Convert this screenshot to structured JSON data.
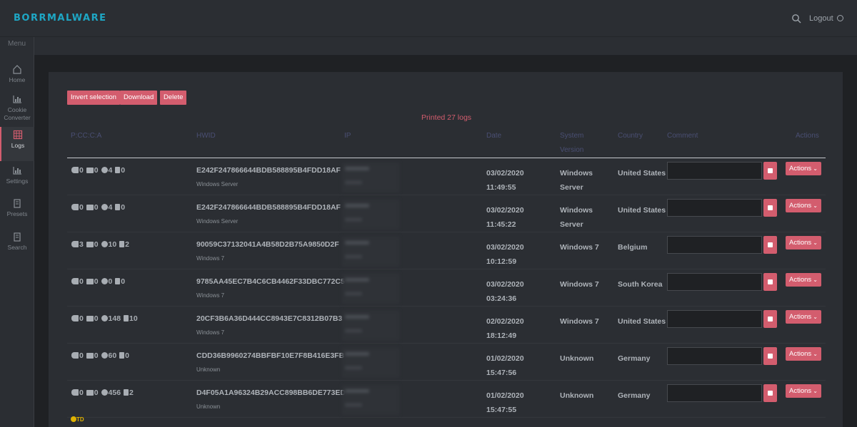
{
  "app": {
    "brand": "BORRMALWARE",
    "logout_label": "Logout"
  },
  "sidebar": {
    "menu_label": "Menu",
    "items": [
      {
        "label": "Home",
        "icon": "home-icon"
      },
      {
        "label": "Cookie Converter",
        "icon": "chart-icon"
      },
      {
        "label": "Logs",
        "icon": "grid-icon",
        "active": true
      },
      {
        "label": "Settings",
        "icon": "chart-icon"
      },
      {
        "label": "Presets",
        "icon": "clipboard-icon"
      },
      {
        "label": "Search",
        "icon": "clipboard-icon"
      }
    ]
  },
  "toolbar": {
    "invert_label": "Invert selection",
    "download_label": "Download",
    "delete_label": "Delete"
  },
  "status": "Printed 27 logs",
  "table": {
    "columns": {
      "pccca": "P:CC:C:A",
      "hwid": "HWID",
      "ip": "IP",
      "date": "Date",
      "system": "System Version",
      "country": "Country",
      "comment": "Comment",
      "actions": "Actions"
    },
    "action_button_label": "Actions",
    "rows": [
      {
        "p": "0",
        "cc": "0",
        "c": "4",
        "a": "0",
        "hwid": "E242F247866644BDB588895B4FDD18AF",
        "os": "Windows Server",
        "date": "03/02/2020",
        "time": "11:49:55",
        "system": "Windows Server",
        "country": "United States"
      },
      {
        "p": "0",
        "cc": "0",
        "c": "4",
        "a": "0",
        "hwid": "E242F247866644BDB588895B4FDD18AF",
        "os": "Windows Server",
        "date": "03/02/2020",
        "time": "11:45:22",
        "system": "Windows Server",
        "country": "United States"
      },
      {
        "p": "3",
        "cc": "0",
        "c": "10",
        "a": "2",
        "hwid": "90059C37132041A4B58D2B75A9850D2F",
        "os": "Windows 7",
        "date": "03/02/2020",
        "time": "10:12:59",
        "system": "Windows 7",
        "country": "Belgium"
      },
      {
        "p": "0",
        "cc": "0",
        "c": "0",
        "a": "0",
        "hwid": "9785AA45EC7B4C6CB4462F33DBC772C5",
        "os": "Windows 7",
        "date": "03/02/2020",
        "time": "03:24:36",
        "system": "Windows 7",
        "country": "South Korea"
      },
      {
        "p": "0",
        "cc": "0",
        "c": "148",
        "a": "10",
        "hwid": "20CF3B6A36D444CC8943E7C8312B07B3",
        "os": "Windows 7",
        "date": "02/02/2020",
        "time": "18:12:49",
        "system": "Windows 7",
        "country": "United States"
      },
      {
        "p": "0",
        "cc": "0",
        "c": "60",
        "a": "0",
        "hwid": "CDD36B9960274BBFBF10E7F8B416E3FB",
        "os": "Unknown",
        "date": "01/02/2020",
        "time": "15:47:56",
        "system": "Unknown",
        "country": "Germany"
      },
      {
        "p": "0",
        "cc": "0",
        "c": "456",
        "a": "2",
        "hwid": "D4F05A1A96324B29ACC898BB6DE773ED",
        "os": "Unknown",
        "date": "01/02/2020",
        "time": "15:47:55",
        "system": "Unknown",
        "country": "Germany"
      }
    ]
  },
  "footer_badge": "TD"
}
